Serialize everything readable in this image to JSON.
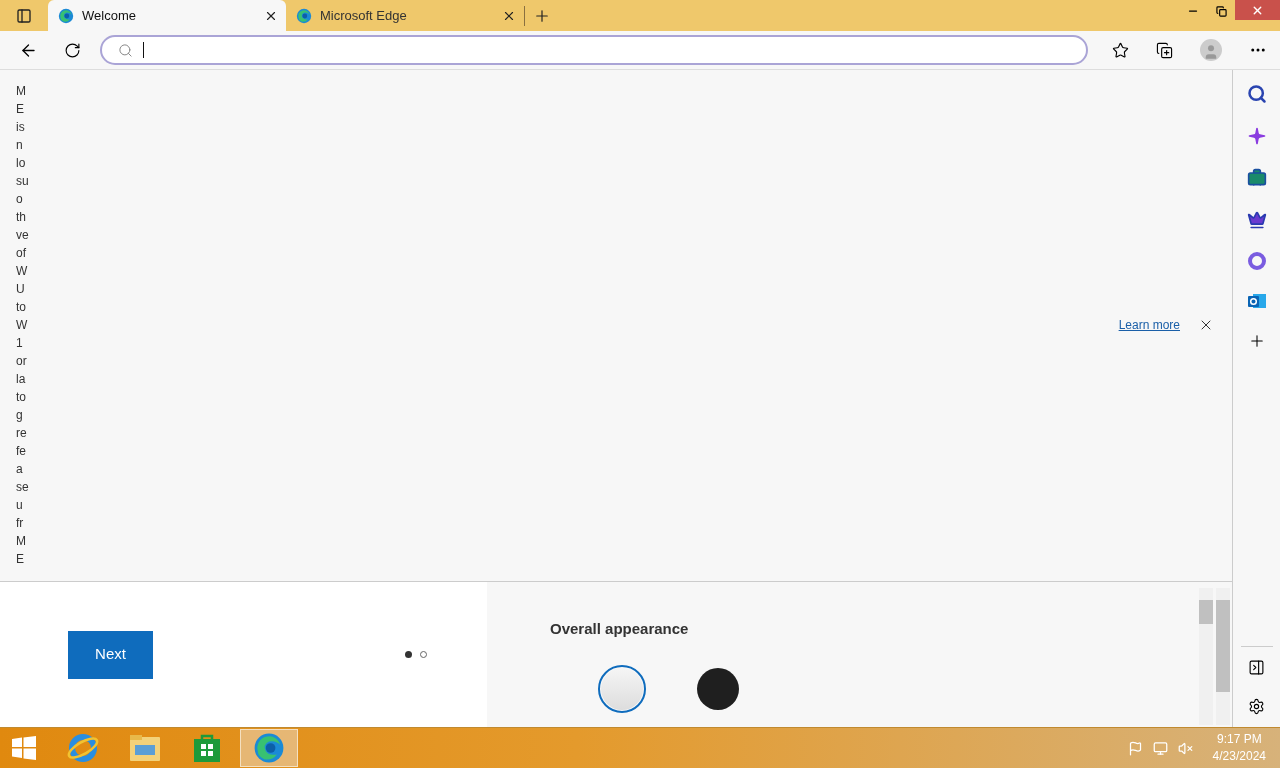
{
  "tabs": [
    {
      "title": "Welcome",
      "selected": true
    },
    {
      "title": "Microsoft Edge",
      "selected": false
    }
  ],
  "banner": {
    "text_fragments": [
      "M",
      "E",
      "is",
      "n",
      "lo",
      "su",
      "o",
      "th",
      "ve",
      "of",
      "W",
      "U",
      "to",
      "W",
      "1",
      "or",
      "la",
      "to",
      "g",
      "re",
      "fe",
      "a",
      "se",
      "u",
      "fr",
      "M",
      "E"
    ],
    "link": "Learn more"
  },
  "setup": {
    "next_button": "Next",
    "pages": [
      {
        "selected": true
      },
      {
        "selected": false
      }
    ],
    "section_title": "Overall appearance",
    "themes": [
      {
        "kind": "light",
        "selected": true
      },
      {
        "kind": "dark",
        "selected": false
      }
    ]
  },
  "taskbar": {
    "apps": [
      {
        "kind": "ie",
        "selected": false
      },
      {
        "kind": "explorer",
        "selected": false
      },
      {
        "kind": "store",
        "selected": false
      },
      {
        "kind": "edge",
        "selected": true
      }
    ],
    "time": "9:17 PM",
    "date": "4/23/2024"
  }
}
